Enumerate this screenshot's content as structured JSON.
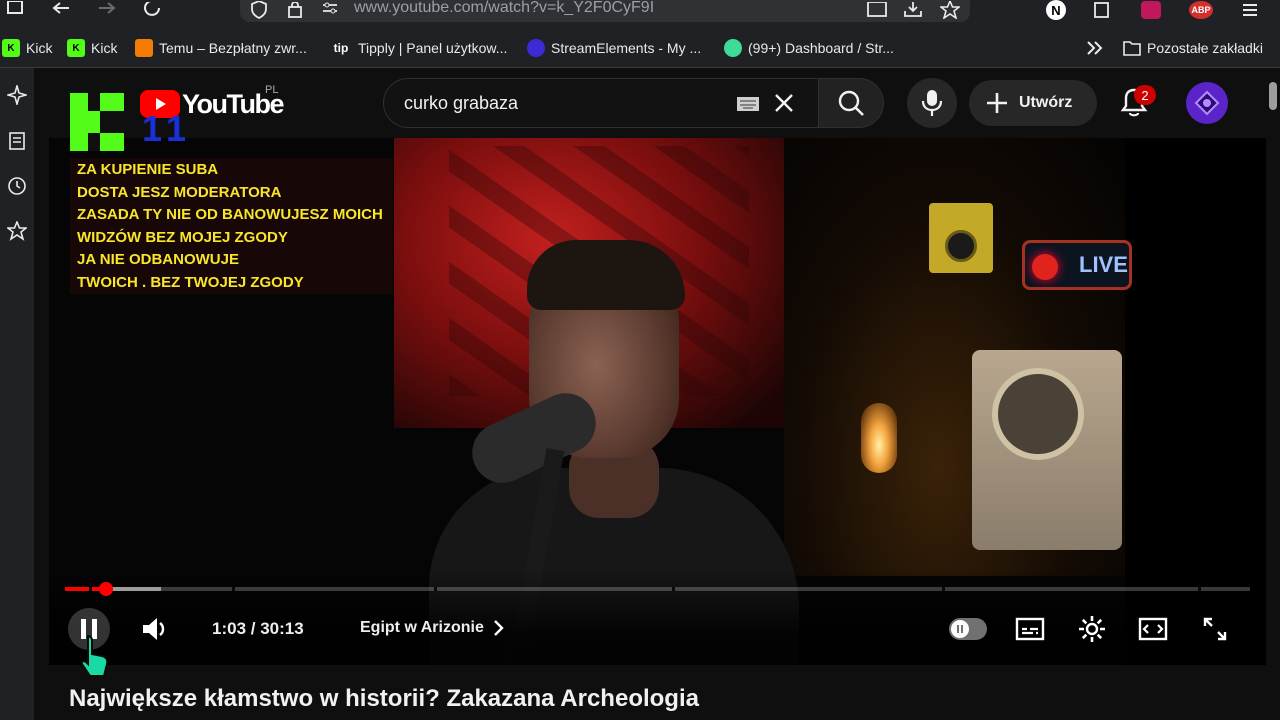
{
  "browser": {
    "url": "www.youtube.com/watch?v=k_Y2F0CyF9I",
    "bookmarks": [
      {
        "label": "Kick"
      },
      {
        "label": "Kick"
      },
      {
        "label": "Temu – Bezpłatny zwr..."
      },
      {
        "label": "Tipply | Panel użytkow..."
      },
      {
        "label": "StreamElements - My ..."
      },
      {
        "label": "(99+) Dashboard / Str..."
      }
    ],
    "other_bookmarks": "Pozostałe zakładki",
    "extensions": {
      "n_badge": "N",
      "abp_badge": "ABP"
    }
  },
  "youtube": {
    "logo_text": "YouTube",
    "region": "PL",
    "search_value": "curko grabaza",
    "create_label": "Utwórz",
    "notification_count": "2"
  },
  "overlay": {
    "number": "11",
    "lines": [
      "ZA KUPIENIE SUBA",
      "DOSTA JESZ MODERATORA",
      "ZASADA  TY NIE OD BANOWUJESZ MOICH",
      "WIDZÓW BEZ MOJEJ ZGODY",
      "JA NIE ODBANOWUJE",
      "TWOICH . BEZ TWOJEJ ZGODY"
    ],
    "live_sign": "LIVE"
  },
  "player": {
    "current_time": "1:03",
    "duration": "30:13",
    "time_display": "1:03 / 30:13",
    "played_fraction": 0.035,
    "chapter": "Egipt w Arizonie",
    "state": "playing",
    "autoplay": "off"
  },
  "video": {
    "title": "Największe kłamstwo w historii? Zakazana Archeologia"
  },
  "colors": {
    "accent": "#ff0000",
    "kick_green": "#53fc18",
    "overlay_text": "#f7e62a",
    "avatar": "#5b24c9"
  }
}
